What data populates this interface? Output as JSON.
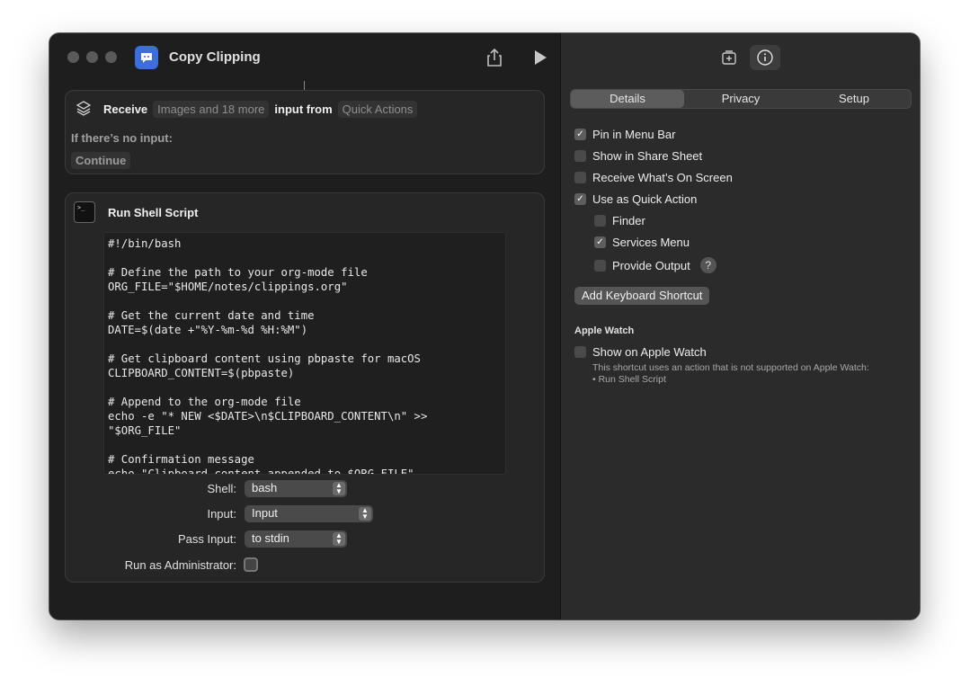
{
  "window": {
    "title": "Copy Clipping"
  },
  "receive": {
    "label": "Receive",
    "types": "Images and 18 more",
    "input_from": "input from",
    "source": "Quick Actions",
    "no_input_label": "If there’s no input:",
    "no_input_action": "Continue"
  },
  "shell": {
    "title": "Run Shell Script",
    "code": "#!/bin/bash\n\n# Define the path to your org-mode file\nORG_FILE=\"$HOME/notes/clippings.org\"\n\n# Get the current date and time\nDATE=$(date +\"%Y-%m-%d %H:%M\")\n\n# Get clipboard content using pbpaste for macOS\nCLIPBOARD_CONTENT=$(pbpaste)\n\n# Append to the org-mode file\necho -e \"* NEW <$DATE>\\n$CLIPBOARD_CONTENT\\n\" >>\n\"$ORG_FILE\"\n\n# Confirmation message\necho \"Clipboard content appended to $ORG_FILE\"",
    "shell_label": "Shell:",
    "shell_value": "bash",
    "input_label": "Input:",
    "input_value": "Input",
    "pass_label": "Pass Input:",
    "pass_value": "to stdin",
    "admin_label": "Run as Administrator:"
  },
  "inspector": {
    "tabs": [
      "Details",
      "Privacy",
      "Setup"
    ],
    "active_tab": "Details",
    "options": [
      {
        "label": "Pin in Menu Bar",
        "checked": true
      },
      {
        "label": "Show in Share Sheet",
        "checked": false
      },
      {
        "label": "Receive What’s On Screen",
        "checked": false
      },
      {
        "label": "Use as Quick Action",
        "checked": true
      }
    ],
    "sub_options": [
      {
        "label": "Finder",
        "checked": false
      },
      {
        "label": "Services Menu",
        "checked": true
      },
      {
        "label": "Provide Output",
        "checked": false
      }
    ],
    "help_symbol": "?",
    "keyboard_button": "Add Keyboard Shortcut",
    "watch_section": "Apple Watch",
    "watch_option": "Show on Apple Watch",
    "watch_note_line1": "This shortcut uses an action that is not supported on Apple Watch:",
    "watch_note_line2": "• Run Shell Script"
  },
  "colors": {
    "app_icon": "#3d6fd8",
    "window_bg": "#1e1e1e",
    "inspector_bg": "#2b2b2b"
  },
  "icons": [
    "speech-bubble-icon",
    "share-icon",
    "play-icon",
    "add-to-library-icon",
    "info-icon",
    "receive-stack-icon",
    "terminal-icon",
    "checkmark-icon",
    "help-icon"
  ]
}
